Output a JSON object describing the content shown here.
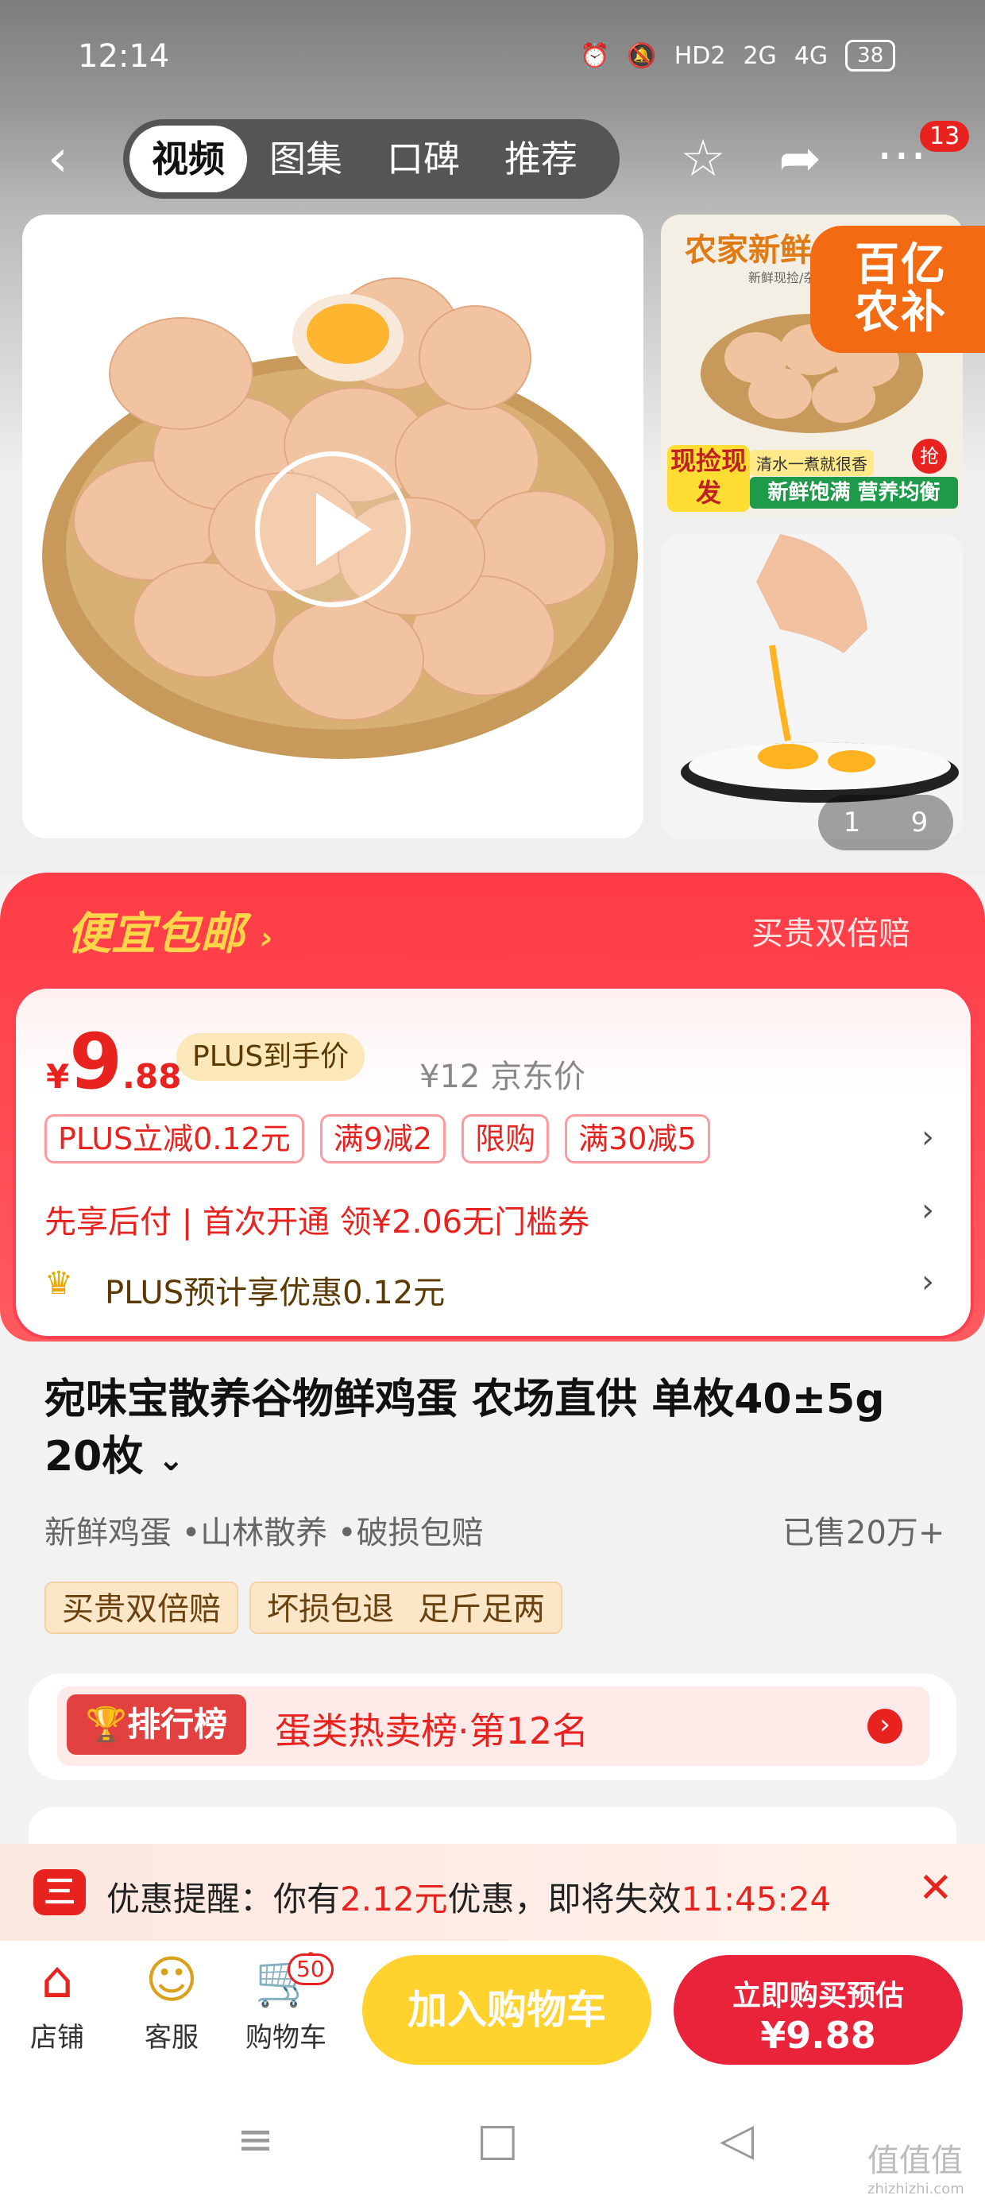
{
  "status_bar": {
    "time": "12:14",
    "network1": "HD2",
    "network2": "2G",
    "network3": "4G",
    "battery": "38"
  },
  "nav": {
    "tabs": [
      {
        "label": "视频",
        "active": true
      },
      {
        "label": "图集",
        "active": false
      },
      {
        "label": "口碑",
        "active": false
      },
      {
        "label": "推荐",
        "active": false
      }
    ],
    "more_badge": "13"
  },
  "gallery": {
    "thumb1_title": "农家新鲜",
    "thumb1_badge": "百亿农补",
    "thumb1_sub": "新鲜现捡/杂粮",
    "thumb1_tag1": "现捡现发",
    "thumb1_tag2": "清水一煮就很香",
    "thumb1_tag3": "新鲜饱满 营养均衡",
    "thumb1_grab": "抢",
    "counter_current": "1",
    "counter_total": "9"
  },
  "promo": {
    "title": "便宜包邮",
    "right_label": "买贵双倍赔",
    "price_currency": "¥",
    "price_int": "9",
    "price_dec": ".88",
    "plus_tag": "PLUS到手价",
    "jd_price": "¥12 京东价",
    "chips": [
      "PLUS立减0.12元",
      "满9减2",
      "限购",
      "满30减5"
    ],
    "pay_later": "先享后付 | 首次开通 领¥2.06无门槛券",
    "plus_benefit": "PLUS预计享优惠0.12元"
  },
  "product": {
    "title": "宛味宝散养谷物鲜鸡蛋 农场直供 单枚40±5g 20枚",
    "tags": "新鲜鸡蛋 •山林散养 •破损包赔",
    "sold": "已售20万+",
    "service_tags": [
      "买贵双倍赔",
      "坏损包退",
      "足斤足两"
    ]
  },
  "rank": {
    "label": "排行榜",
    "text": "蛋类热卖榜·第12名"
  },
  "reminder": {
    "icon": "三",
    "prefix": "优惠提醒：你有",
    "amount": "2.12元",
    "middle": "优惠，即将失效",
    "countdown": "11:45:24"
  },
  "bottom_bar": {
    "shop": "店铺",
    "service": "客服",
    "cart": "购物车",
    "cart_badge": "50",
    "add_to_cart": "加入购物车",
    "buy_line1": "立即购买预估",
    "buy_line2": "¥9.88"
  },
  "watermark": "值值值",
  "watermark_sub": "zhizhizhi.com"
}
